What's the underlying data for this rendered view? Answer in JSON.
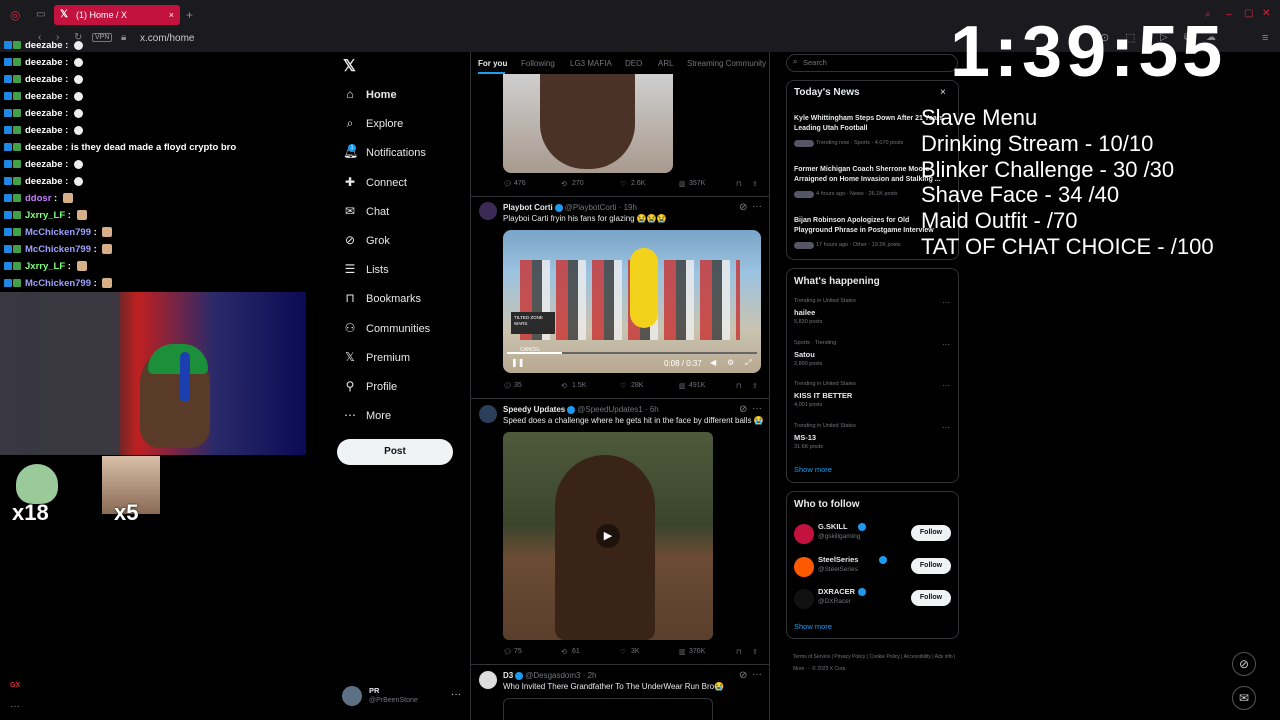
{
  "browser": {
    "tab_title": "(1) Home / X",
    "url": "x.com/home",
    "vpn_label": "VPN",
    "new_tab_label": "+"
  },
  "chat": {
    "lines": [
      {
        "user": "deezabe",
        "msg": ""
      },
      {
        "user": "deezabe",
        "msg": ""
      },
      {
        "user": "deezabe",
        "msg": ""
      },
      {
        "user": "deezabe",
        "msg": ""
      },
      {
        "user": "deezabe",
        "msg": ""
      },
      {
        "user": "deezabe",
        "msg": ""
      },
      {
        "user": "deezabe",
        "msg": "is they dead made a floyd crypto bro"
      },
      {
        "user": "deezabe",
        "msg": ""
      },
      {
        "user": "deezabe",
        "msg": ""
      },
      {
        "user": "ddosr",
        "msg": ""
      },
      {
        "user": "Jxrry_LF",
        "msg": ""
      },
      {
        "user": "McChicken799",
        "msg": ""
      },
      {
        "user": "McChicken799",
        "msg": ""
      },
      {
        "user": "Jxrry_LF",
        "msg": ""
      },
      {
        "user": "McChicken799",
        "msg": ""
      }
    ],
    "colors": {
      "deezabe": "#ffffff",
      "ddosr": "#c77dff",
      "Jxrry_LF": "#7fff7f",
      "McChicken799": "#a0a0ff"
    },
    "emote_counts": [
      "x18",
      "x5"
    ],
    "gx_label": "GX"
  },
  "nav": {
    "items": [
      {
        "label": "Home",
        "icon": "home-icon"
      },
      {
        "label": "Explore",
        "icon": "search-icon"
      },
      {
        "label": "Notifications",
        "icon": "bell-icon"
      },
      {
        "label": "Connect",
        "icon": "add-user-icon"
      },
      {
        "label": "Chat",
        "icon": "mail-icon"
      },
      {
        "label": "Grok",
        "icon": "grok-icon"
      },
      {
        "label": "Lists",
        "icon": "list-icon"
      },
      {
        "label": "Bookmarks",
        "icon": "bookmark-icon"
      },
      {
        "label": "Communities",
        "icon": "people-icon"
      },
      {
        "label": "Premium",
        "icon": "x-icon"
      },
      {
        "label": "Profile",
        "icon": "person-icon"
      },
      {
        "label": "More",
        "icon": "more-icon"
      }
    ],
    "post_label": "Post",
    "profile_name": "PR",
    "profile_handle": "@PrBeenStone",
    "notif_count": "1"
  },
  "feed": {
    "tabs": [
      "For you",
      "Following",
      "LG3 MAFIA",
      "DEO",
      "ARL",
      "Streaming Community"
    ],
    "tweet1_stats": {
      "replies": "476",
      "retweets": "270",
      "likes": "2.6K",
      "views": "357K"
    },
    "tweet2": {
      "name": "Playbot Corti",
      "handle": "@PlaybotCorti · 19h",
      "text": "Playboi Carti fryin his fans for glazing 😭😭😭",
      "video_time": "0:08 / 0:37",
      "video_progress": 0.22,
      "overlay_label1": "TILTED ZONE WARS",
      "overlay_label2": "CANCEL",
      "stats": {
        "replies": "35",
        "retweets": "1.5K",
        "likes": "28K",
        "views": "491K"
      }
    },
    "tweet3": {
      "name": "Speedy Updates",
      "handle": "@SpeedUpdates1 · 6h",
      "text": "Speed does a challenge where he gets hit in the face by different balls 😭",
      "stats": {
        "replies": "75",
        "retweets": "61",
        "likes": "3K",
        "views": "376K"
      }
    },
    "tweet4": {
      "name": "D3",
      "handle": "@Desgasdom3 · 2h",
      "text": "Who Invited There Grandfather To The UnderWear Run Bro😭"
    }
  },
  "right": {
    "search_placeholder": "Search",
    "news_title": "Today's News",
    "news": [
      {
        "title": "Kyle Whittingham Steps Down After 21 Years Leading Utah Football",
        "meta": "Trending now · Sports · 4,070 posts"
      },
      {
        "title": "Former Michigan Coach Sherrone Moore Arraigned on Home Invasion and Stalking ...",
        "meta": "4 hours ago · News · 26.1K posts"
      },
      {
        "title": "Bijan Robinson Apologizes for Old Playground Phrase in Postgame Interview",
        "meta": "17 hours ago · Other · 19.2K posts"
      }
    ],
    "happening_title": "What's happening",
    "trends": [
      {
        "context": "Trending in United States",
        "name": "hailee",
        "posts": "5,830 posts"
      },
      {
        "context": "Sports · Trending",
        "name": "Satou",
        "posts": "2,890 posts"
      },
      {
        "context": "Trending in United States",
        "name": "KISS IT BETTER",
        "posts": "4,001 posts"
      },
      {
        "context": "Trending in United States",
        "name": "MS-13",
        "posts": "31.6K posts"
      }
    ],
    "show_more": "Show more",
    "wtf_title": "Who to follow",
    "wtf": [
      {
        "name": "G.SKILL",
        "handle": "@gskillgaming",
        "color": "#c4123e"
      },
      {
        "name": "SteelSeries",
        "handle": "@SteelSeries",
        "color": "#ff5a00"
      },
      {
        "name": "DXRACER",
        "handle": "@DXRacer",
        "color": "#111111"
      }
    ],
    "follow_label": "Follow",
    "footer": "Terms of Service | Privacy Policy | Cookie Policy | Accessibility | Ads info | More ··· © 2025 X Corp."
  },
  "overlay": {
    "timer": "1:39:55",
    "menu": [
      "Slave Menu",
      "Drinking Stream  -  10/10",
      "Blinker Challenge  -  30 /30",
      "Shave Face  -  34 /40",
      "Maid Outfit -  /70",
      " TAT OF CHAT CHOICE -  /100"
    ]
  }
}
